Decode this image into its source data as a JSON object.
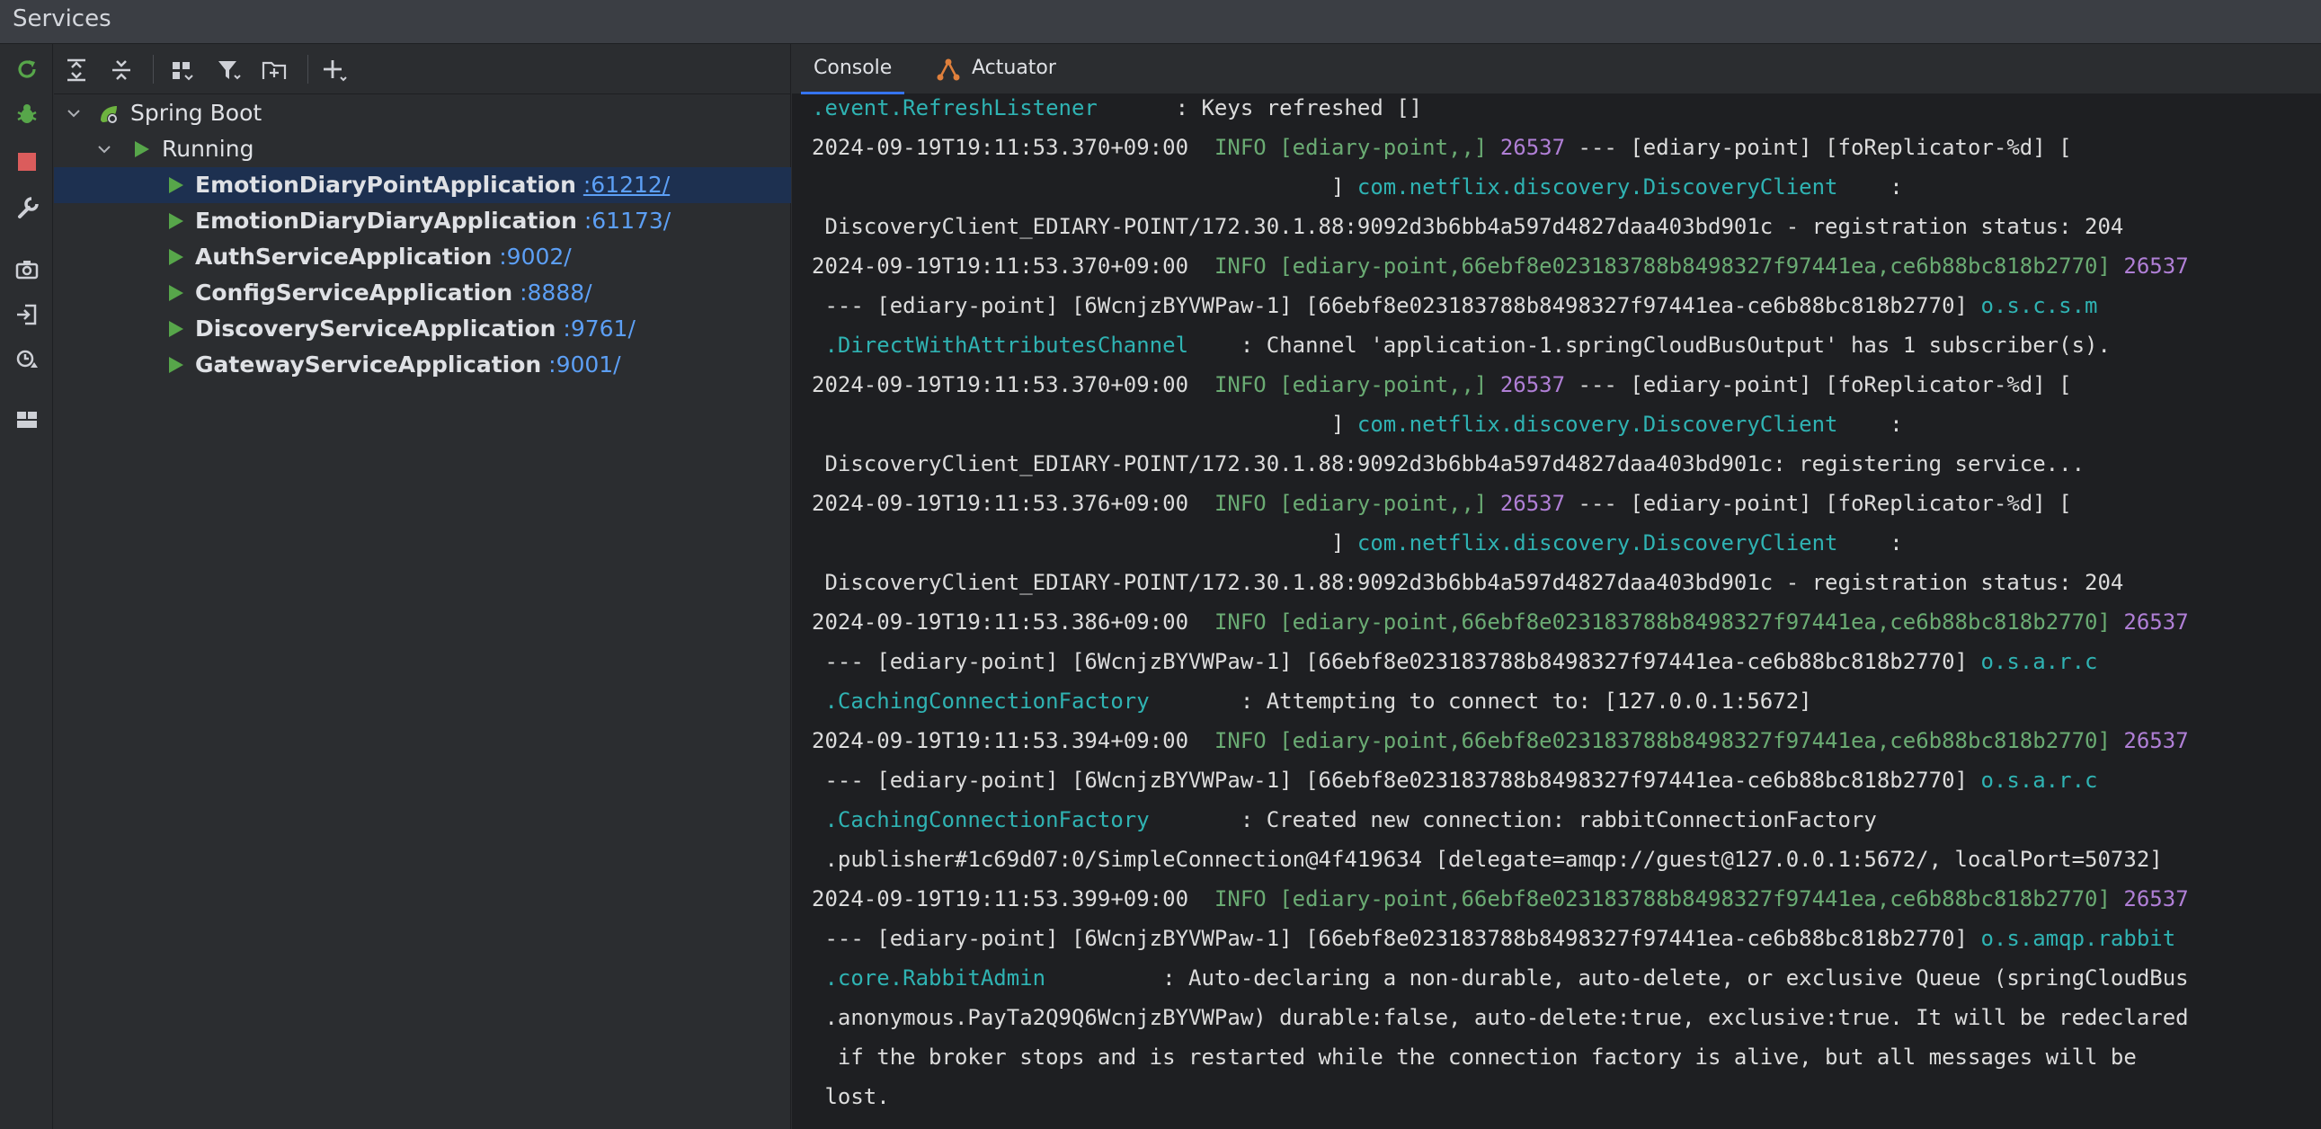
{
  "window": {
    "title": "Services"
  },
  "tree": {
    "root": "Spring Boot",
    "group": "Running",
    "apps": [
      {
        "name": "EmotionDiaryPointApplication",
        "port": ":61212/"
      },
      {
        "name": "EmotionDiaryDiaryApplication",
        "port": ":61173/"
      },
      {
        "name": "AuthServiceApplication",
        "port": ":9002/"
      },
      {
        "name": "ConfigServiceApplication",
        "port": ":8888/"
      },
      {
        "name": "DiscoveryServiceApplication",
        "port": ":9761/"
      },
      {
        "name": "GatewayServiceApplication",
        "port": ":9001/"
      }
    ]
  },
  "tabs": {
    "console": "Console",
    "actuator": "Actuator"
  },
  "console": {
    "lines": [
      [
        {
          "t": ".event.RefreshListener",
          "c": "cls"
        },
        {
          "t": "      : Keys refreshed []",
          "c": "plain"
        }
      ],
      [
        {
          "t": "2024-09-19T19:11:53.370+09:00  ",
          "c": "plain"
        },
        {
          "t": "INFO ",
          "c": "info"
        },
        {
          "t": "[ediary-point,,]",
          "c": "ctx"
        },
        {
          "t": " ",
          "c": "plain"
        },
        {
          "t": "26537",
          "c": "pid"
        },
        {
          "t": " --- [ediary-point] [foReplicator-%d] [",
          "c": "plain"
        }
      ],
      [
        {
          "t": "                                        ] ",
          "c": "plain"
        },
        {
          "t": "com.netflix.discovery.DiscoveryClient",
          "c": "cls"
        },
        {
          "t": "    :",
          "c": "plain"
        }
      ],
      [
        {
          "t": " DiscoveryClient_EDIARY-POINT/172.30.1.88:9092d3b6bb4a597d4827daa403bd901c - registration status: 204",
          "c": "plain"
        }
      ],
      [
        {
          "t": "2024-09-19T19:11:53.370+09:00  ",
          "c": "plain"
        },
        {
          "t": "INFO ",
          "c": "info"
        },
        {
          "t": "[ediary-point,66ebf8e023183788b8498327f97441ea,ce6b88bc818b2770]",
          "c": "ctx"
        },
        {
          "t": " ",
          "c": "plain"
        },
        {
          "t": "26537",
          "c": "pid"
        }
      ],
      [
        {
          "t": " --- [ediary-point] [6WcnjzBYVWPaw-1] [66ebf8e023183788b8498327f97441ea-ce6b88bc818b2770] ",
          "c": "plain"
        },
        {
          "t": "o.s.c.s.m",
          "c": "cls"
        }
      ],
      [
        {
          "t": " .DirectWithAttributesChannel",
          "c": "cls"
        },
        {
          "t": "    : Channel 'application-1.springCloudBusOutput' has 1 subscriber(s).",
          "c": "plain"
        }
      ],
      [
        {
          "t": "2024-09-19T19:11:53.370+09:00  ",
          "c": "plain"
        },
        {
          "t": "INFO ",
          "c": "info"
        },
        {
          "t": "[ediary-point,,]",
          "c": "ctx"
        },
        {
          "t": " ",
          "c": "plain"
        },
        {
          "t": "26537",
          "c": "pid"
        },
        {
          "t": " --- [ediary-point] [foReplicator-%d] [",
          "c": "plain"
        }
      ],
      [
        {
          "t": "                                        ] ",
          "c": "plain"
        },
        {
          "t": "com.netflix.discovery.DiscoveryClient",
          "c": "cls"
        },
        {
          "t": "    :",
          "c": "plain"
        }
      ],
      [
        {
          "t": " DiscoveryClient_EDIARY-POINT/172.30.1.88:9092d3b6bb4a597d4827daa403bd901c: registering service...",
          "c": "plain"
        }
      ],
      [
        {
          "t": "2024-09-19T19:11:53.376+09:00  ",
          "c": "plain"
        },
        {
          "t": "INFO ",
          "c": "info"
        },
        {
          "t": "[ediary-point,,]",
          "c": "ctx"
        },
        {
          "t": " ",
          "c": "plain"
        },
        {
          "t": "26537",
          "c": "pid"
        },
        {
          "t": " --- [ediary-point] [foReplicator-%d] [",
          "c": "plain"
        }
      ],
      [
        {
          "t": "                                        ] ",
          "c": "plain"
        },
        {
          "t": "com.netflix.discovery.DiscoveryClient",
          "c": "cls"
        },
        {
          "t": "    :",
          "c": "plain"
        }
      ],
      [
        {
          "t": " DiscoveryClient_EDIARY-POINT/172.30.1.88:9092d3b6bb4a597d4827daa403bd901c - registration status: 204",
          "c": "plain"
        }
      ],
      [
        {
          "t": "2024-09-19T19:11:53.386+09:00  ",
          "c": "plain"
        },
        {
          "t": "INFO ",
          "c": "info"
        },
        {
          "t": "[ediary-point,66ebf8e023183788b8498327f97441ea,ce6b88bc818b2770]",
          "c": "ctx"
        },
        {
          "t": " ",
          "c": "plain"
        },
        {
          "t": "26537",
          "c": "pid"
        }
      ],
      [
        {
          "t": " --- [ediary-point] [6WcnjzBYVWPaw-1] [66ebf8e023183788b8498327f97441ea-ce6b88bc818b2770] ",
          "c": "plain"
        },
        {
          "t": "o.s.a.r.c",
          "c": "cls"
        }
      ],
      [
        {
          "t": " .CachingConnectionFactory",
          "c": "cls"
        },
        {
          "t": "       : Attempting to connect to: [127.0.0.1:5672]",
          "c": "plain"
        }
      ],
      [
        {
          "t": "2024-09-19T19:11:53.394+09:00  ",
          "c": "plain"
        },
        {
          "t": "INFO ",
          "c": "info"
        },
        {
          "t": "[ediary-point,66ebf8e023183788b8498327f97441ea,ce6b88bc818b2770]",
          "c": "ctx"
        },
        {
          "t": " ",
          "c": "plain"
        },
        {
          "t": "26537",
          "c": "pid"
        }
      ],
      [
        {
          "t": " --- [ediary-point] [6WcnjzBYVWPaw-1] [66ebf8e023183788b8498327f97441ea-ce6b88bc818b2770] ",
          "c": "plain"
        },
        {
          "t": "o.s.a.r.c",
          "c": "cls"
        }
      ],
      [
        {
          "t": " .CachingConnectionFactory",
          "c": "cls"
        },
        {
          "t": "       : Created new connection: rabbitConnectionFactory",
          "c": "plain"
        }
      ],
      [
        {
          "t": " .publisher#1c69d07:0/SimpleConnection@4f419634 [delegate=amqp://guest@127.0.0.1:5672/, localPort=50732]",
          "c": "plain"
        }
      ],
      [
        {
          "t": "2024-09-19T19:11:53.399+09:00  ",
          "c": "plain"
        },
        {
          "t": "INFO ",
          "c": "info"
        },
        {
          "t": "[ediary-point,66ebf8e023183788b8498327f97441ea,ce6b88bc818b2770]",
          "c": "ctx"
        },
        {
          "t": " ",
          "c": "plain"
        },
        {
          "t": "26537",
          "c": "pid"
        }
      ],
      [
        {
          "t": " --- [ediary-point] [6WcnjzBYVWPaw-1] [66ebf8e023183788b8498327f97441ea-ce6b88bc818b2770] ",
          "c": "plain"
        },
        {
          "t": "o.s.amqp.rabbit",
          "c": "cls"
        }
      ],
      [
        {
          "t": " .core.RabbitAdmin",
          "c": "cls"
        },
        {
          "t": "         : Auto-declaring a non-durable, auto-delete, or exclusive Queue (springCloudBus",
          "c": "plain"
        }
      ],
      [
        {
          "t": " .anonymous.PayTa2Q9Q6WcnjzBYVWPaw) durable:false, auto-delete:true, exclusive:true. It will be redeclared",
          "c": "plain"
        }
      ],
      [
        {
          "t": "  if the broker stops and is restarted while the connection factory is alive, but all messages will be",
          "c": "plain"
        }
      ],
      [
        {
          "t": " lost.",
          "c": "plain"
        }
      ]
    ]
  },
  "colors": {
    "accent": "#3574f0",
    "run_green": "#57a64a",
    "stop_red": "#db5c5c",
    "port_blue": "#5c9ff5",
    "log_info": "#6aab73",
    "log_pid": "#b07fd6",
    "log_class": "#2fb3b3"
  }
}
